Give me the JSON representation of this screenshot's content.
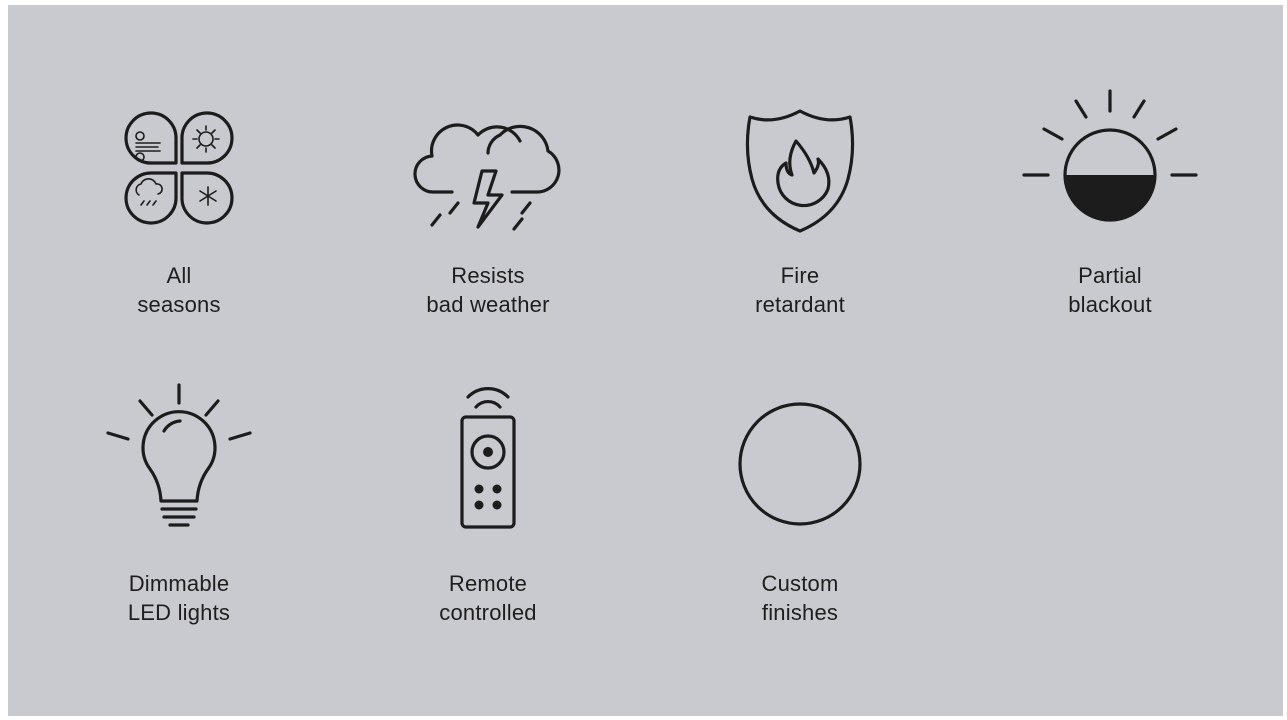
{
  "features": [
    {
      "line1": "All",
      "line2": "seasons",
      "icon": "four-seasons-icon"
    },
    {
      "line1": "Resists",
      "line2": "bad weather",
      "icon": "storm-cloud-icon"
    },
    {
      "line1": "Fire",
      "line2": "retardant",
      "icon": "fire-shield-icon"
    },
    {
      "line1": "Partial",
      "line2": "blackout",
      "icon": "half-sun-icon"
    },
    {
      "line1": "Dimmable",
      "line2": "LED lights",
      "icon": "light-bulb-icon"
    },
    {
      "line1": "Remote",
      "line2": "controlled",
      "icon": "remote-control-icon"
    },
    {
      "line1": "Custom",
      "line2": "finishes",
      "icon": "circle-icon"
    }
  ],
  "colors": {
    "background": "#c8cad0",
    "icon": "#1c1c1c",
    "text": "#1e1e1e"
  }
}
